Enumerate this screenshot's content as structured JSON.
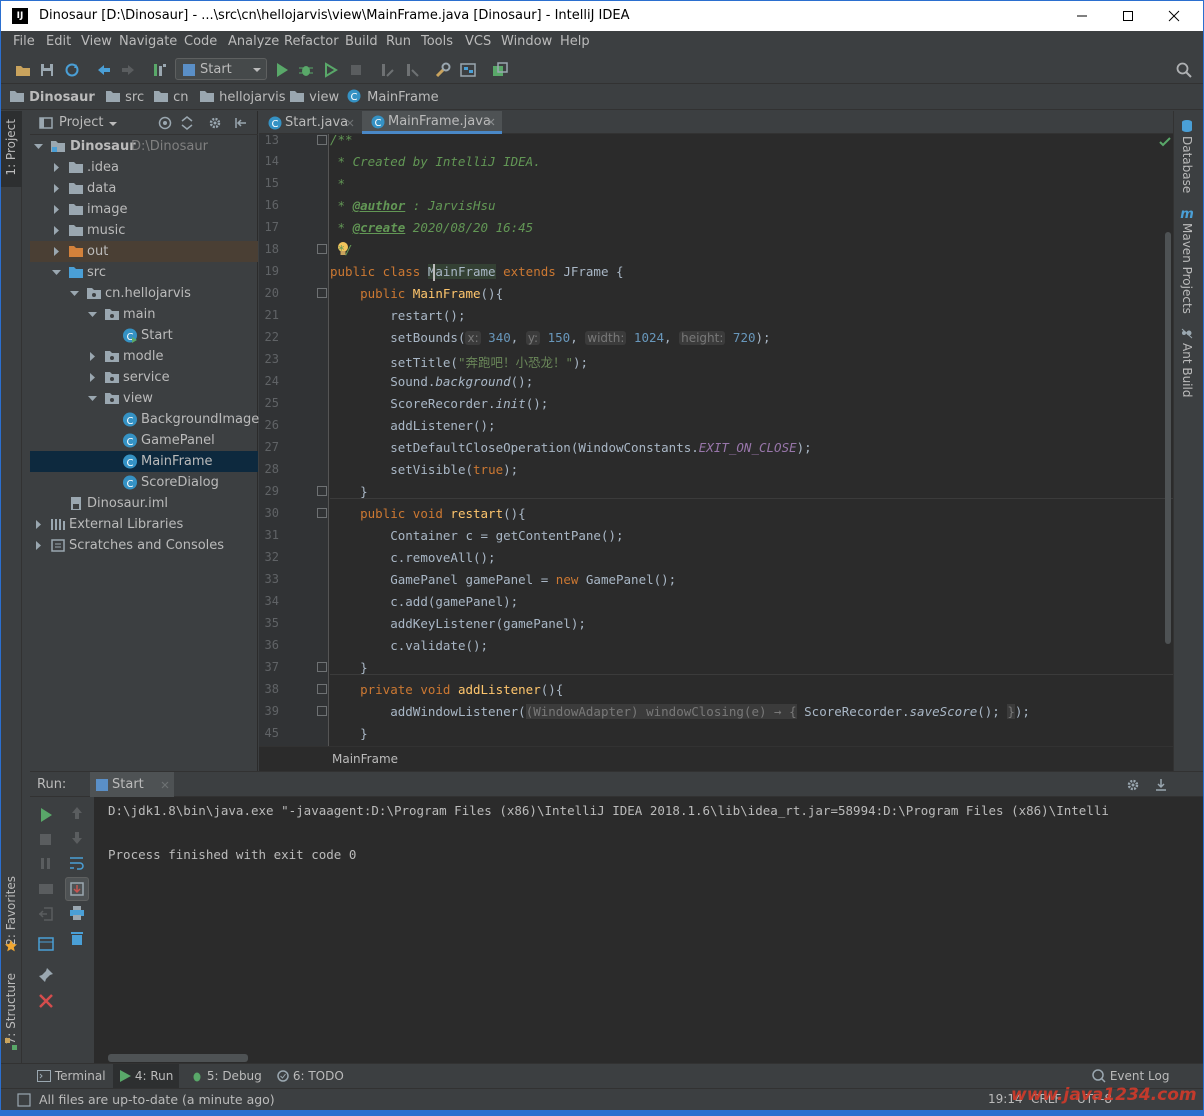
{
  "window": {
    "title": "Dinosaur [D:\\Dinosaur] - ...\\src\\cn\\hellojarvis\\view\\MainFrame.java [Dinosaur] - IntelliJ IDEA",
    "app_icon_label": "IJ"
  },
  "menu": [
    "File",
    "Edit",
    "View",
    "Navigate",
    "Code",
    "Analyze",
    "Refactor",
    "Build",
    "Run",
    "Tools",
    "VCS",
    "Window",
    "Help"
  ],
  "toolbar": {
    "run_config": "Start"
  },
  "navbar": [
    "Dinosaur",
    "src",
    "cn",
    "hellojarvis",
    "view",
    "MainFrame"
  ],
  "left_tools": {
    "project": "1: Project",
    "favorites": "2: Favorites",
    "structure": "7: Structure"
  },
  "right_tools": {
    "database": "Database",
    "maven": "Maven Projects",
    "ant": "Ant Build"
  },
  "project": {
    "header": "Project",
    "tree": [
      {
        "label": "Dinosaur",
        "extra": "D:\\Dinosaur"
      },
      {
        "label": ".idea"
      },
      {
        "label": "data"
      },
      {
        "label": "image"
      },
      {
        "label": "music"
      },
      {
        "label": "out"
      },
      {
        "label": "src"
      },
      {
        "label": "cn.hellojarvis"
      },
      {
        "label": "main"
      },
      {
        "label": "Start"
      },
      {
        "label": "modle"
      },
      {
        "label": "service"
      },
      {
        "label": "view"
      },
      {
        "label": "BackgroundImage"
      },
      {
        "label": "GamePanel"
      },
      {
        "label": "MainFrame"
      },
      {
        "label": "ScoreDialog"
      },
      {
        "label": "Dinosaur.iml"
      },
      {
        "label": "External Libraries"
      },
      {
        "label": "Scratches and Consoles"
      }
    ]
  },
  "editor": {
    "tabs": [
      "Start.java",
      "MainFrame.java"
    ],
    "active_tab": "MainFrame.java",
    "breadcrumb": "MainFrame",
    "line_numbers": [
      "13",
      "14",
      "15",
      "16",
      "17",
      "18",
      "19",
      "20",
      "21",
      "22",
      "23",
      "24",
      "25",
      "26",
      "27",
      "28",
      "29",
      "30",
      "31",
      "32",
      "33",
      "34",
      "35",
      "36",
      "37",
      "38",
      "39",
      "45"
    ],
    "code": {
      "l13": "/**",
      "l14": " * Created by IntelliJ IDEA.",
      "l15": " *",
      "l16_tag": "@author",
      "l16_rest": " : JarvisHsu",
      "l17_tag": "@create",
      "l17_rest": " 2020/08/20 16:45",
      "l18": " */",
      "l19_a": "public class ",
      "l19_b": "MainFrame",
      "l19_c": " extends ",
      "l19_d": "JFrame {",
      "l20_a": "public ",
      "l20_b": "MainFrame",
      "l20_c": "(){",
      "l21": "restart();",
      "l22_a": "setBounds(",
      "l22_hx": "x:",
      "l22_vx": "340",
      "l22_hy": "y:",
      "l22_vy": "150",
      "l22_hw": "width:",
      "l22_vw": "1024",
      "l22_hh": "height:",
      "l22_vh": "720",
      "l23_a": "setTitle(",
      "l23_s": "\"奔跑吧！小恐龙！\"",
      "l23_c": ");",
      "l24_a": "Sound.",
      "l24_b": "background",
      "l24_c": "();",
      "l25_a": "ScoreRecorder.",
      "l25_b": "init",
      "l25_c": "();",
      "l26": "addListener();",
      "l27_a": "setDefaultCloseOperation(WindowConstants.",
      "l27_b": "EXIT_ON_CLOSE",
      "l27_c": ");",
      "l28_a": "setVisible(",
      "l28_b": "true",
      "l28_c": ");",
      "l29": "}",
      "l30_a": "public void ",
      "l30_b": "restart",
      "l30_c": "(){",
      "l31": "Container c = getContentPane();",
      "l32": "c.removeAll();",
      "l33_a": "GamePanel gamePanel = ",
      "l33_b": "new",
      "l33_c": " GamePanel();",
      "l34": "c.add(gamePanel);",
      "l35": "addKeyListener(gamePanel);",
      "l36": "c.validate();",
      "l37": "}",
      "l38_a": "private void ",
      "l38_b": "addListener",
      "l38_c": "(){",
      "l39_a": "addWindowListener(",
      "l39_f1": "(WindowAdapter) windowClosing(e) → {",
      "l39_b": " ScoreRecorder.",
      "l39_c": "saveScore",
      "l39_d": "(); ",
      "l39_f2": "}",
      "l39_e": ");",
      "l45": "}"
    }
  },
  "run": {
    "label": "Run:",
    "tab": "Start",
    "console": [
      "D:\\jdk1.8\\bin\\java.exe \"-javaagent:D:\\Program Files (x86)\\IntelliJ IDEA 2018.1.6\\lib\\idea_rt.jar=58994:D:\\Program Files (x86)\\Intelli",
      "",
      "Process finished with exit code 0"
    ]
  },
  "bottom_tabs": {
    "terminal": "Terminal",
    "run": "4: Run",
    "debug": "5: Debug",
    "todo": "6: TODO",
    "event_log": "Event Log"
  },
  "status": {
    "message": "All files are up-to-date (a minute ago)",
    "position": "19:14",
    "line_sep": "CRLF",
    "encoding": "UTF-8"
  },
  "watermark": "www.java1234.com",
  "colors": {
    "accent": "#2b6fcf",
    "keyword": "#cc7832",
    "function": "#ffc66d",
    "number": "#6897bb",
    "string": "#6a8759",
    "comment": "#629755",
    "run_green": "#59a869",
    "selection": "#0d293e"
  }
}
